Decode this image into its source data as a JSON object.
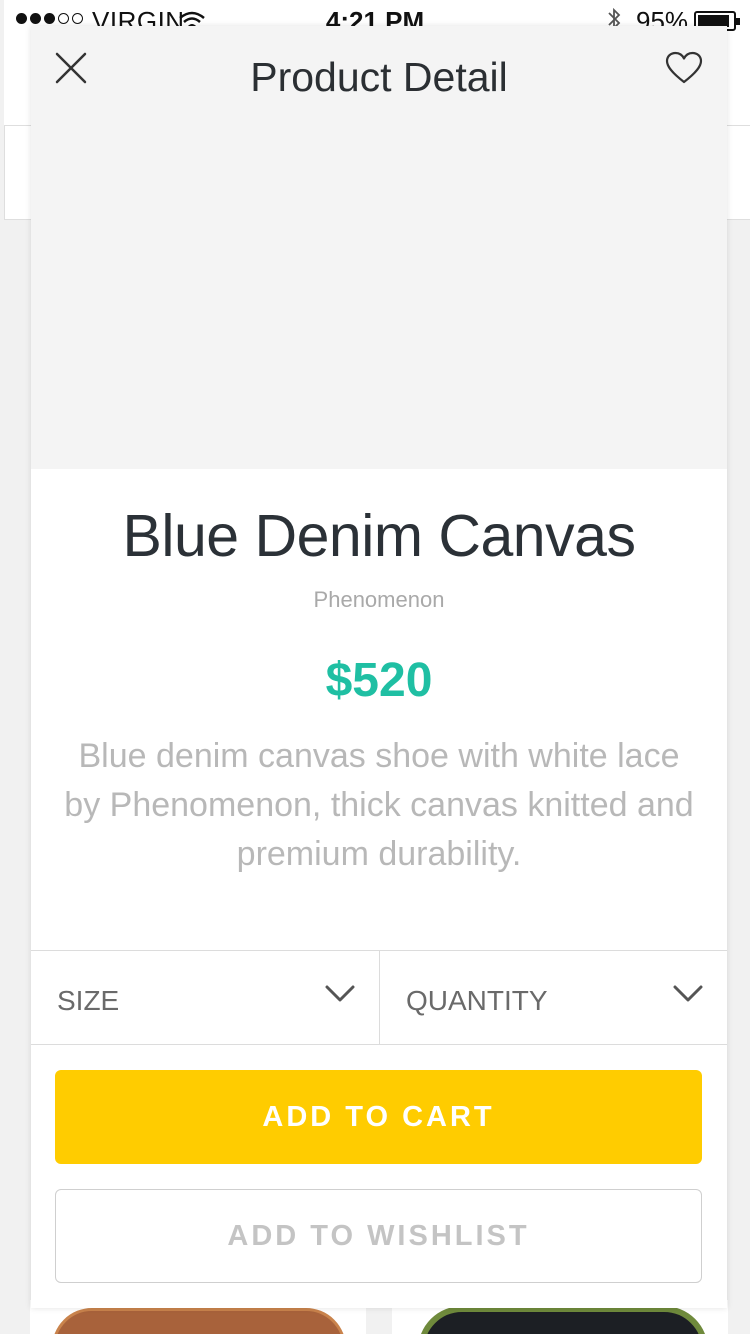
{
  "status_bar": {
    "carrier": "VIRGIN",
    "time": "4:21 PM",
    "battery": "95%"
  },
  "header": {
    "title": "Product Detail",
    "close_icon": "close-icon",
    "favorite_icon": "heart-icon"
  },
  "product": {
    "name": "Blue Denim Canvas",
    "brand": "Phenomenon",
    "price": "$520",
    "description": "Blue denim canvas shoe with white lace by Phenomenon, thick canvas knitted and premium durability."
  },
  "selectors": {
    "size_label": "SIZE",
    "quantity_label": "QUANTITY"
  },
  "actions": {
    "add_to_cart": "ADD TO CART",
    "add_to_wishlist": "ADD TO WISHLIST"
  },
  "colors": {
    "accent_price": "#1fbfa3",
    "cart_button": "#ffcc00"
  }
}
